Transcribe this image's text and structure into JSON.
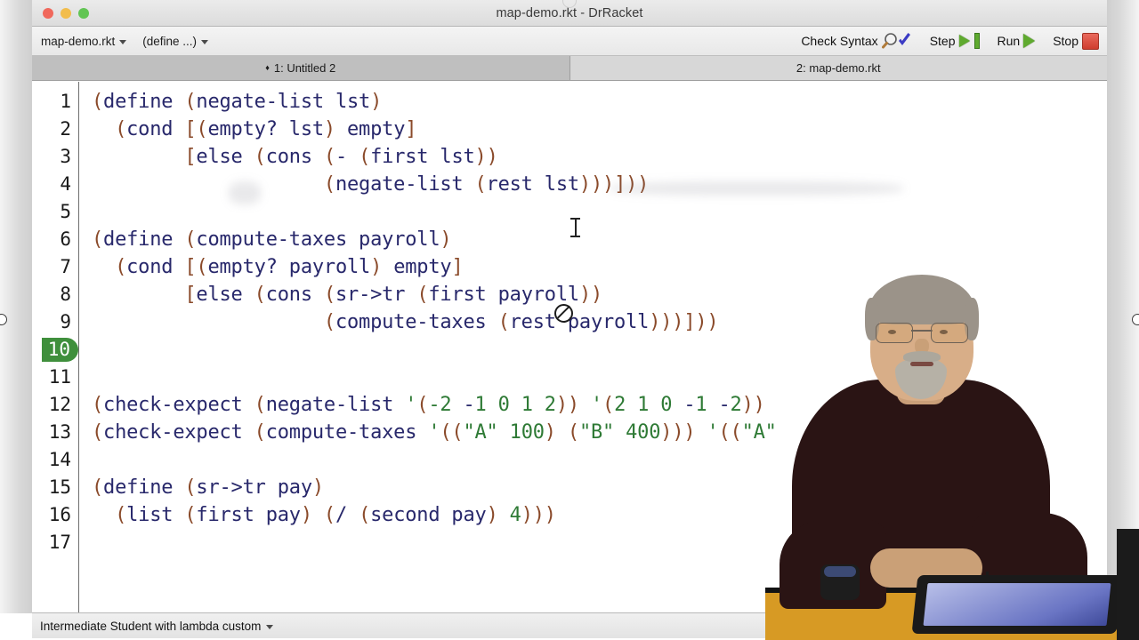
{
  "window": {
    "title": "map-demo.rkt - DrRacket",
    "traffic_lights": [
      "close",
      "minimize",
      "zoom"
    ]
  },
  "toolbar": {
    "file_menu_label": "map-demo.rkt",
    "definition_menu_label": "(define ...)",
    "check_syntax_label": "Check Syntax",
    "step_label": "Step",
    "run_label": "Run",
    "stop_label": "Stop"
  },
  "tabs": [
    {
      "label": "1: Untitled 2",
      "marker": "♦",
      "active": true
    },
    {
      "label": "2: map-demo.rkt",
      "marker": "",
      "active": false
    }
  ],
  "editor": {
    "current_line": 10,
    "line_numbers": [
      "1",
      "2",
      "3",
      "4",
      "5",
      "6",
      "7",
      "8",
      "9",
      "10",
      "11",
      "12",
      "13",
      "14",
      "15",
      "16",
      "17"
    ],
    "lines": [
      {
        "n": 1,
        "text": "(define (negate-list lst)"
      },
      {
        "n": 2,
        "text": "  (cond [(empty? lst) empty]"
      },
      {
        "n": 3,
        "text": "        [else (cons (- (first lst))"
      },
      {
        "n": 4,
        "text": "                    (negate-list (rest lst)))]))"
      },
      {
        "n": 5,
        "text": ""
      },
      {
        "n": 6,
        "text": "(define (compute-taxes payroll)"
      },
      {
        "n": 7,
        "text": "  (cond [(empty? payroll) empty]"
      },
      {
        "n": 8,
        "text": "        [else (cons (sr->tr (first payroll))"
      },
      {
        "n": 9,
        "text": "                    (compute-taxes (rest payroll)))]))"
      },
      {
        "n": 10,
        "text": ""
      },
      {
        "n": 11,
        "text": ""
      },
      {
        "n": 12,
        "text": "(check-expect (negate-list '(-2 -1 0 1 2)) '(2 1 0 -1 -2))"
      },
      {
        "n": 13,
        "text": "(check-expect (compute-taxes '((\"A\" 100) (\"B\" 400))) '((\"A\""
      },
      {
        "n": 14,
        "text": ""
      },
      {
        "n": 15,
        "text": "(define (sr->tr pay)"
      },
      {
        "n": 16,
        "text": "  (list (first pay) (/ (second pay) 4)))"
      },
      {
        "n": 17,
        "text": ""
      }
    ]
  },
  "statusbar": {
    "language_label": "Intermediate Student with lambda custom"
  },
  "colors": {
    "paren": "#8a4a2a",
    "keyword": "#28286b",
    "literal": "#2e7a35",
    "current_line_badge": "#3f8f3c",
    "run_icon": "#5faa2f",
    "stop_icon": "#cf3d2e"
  }
}
